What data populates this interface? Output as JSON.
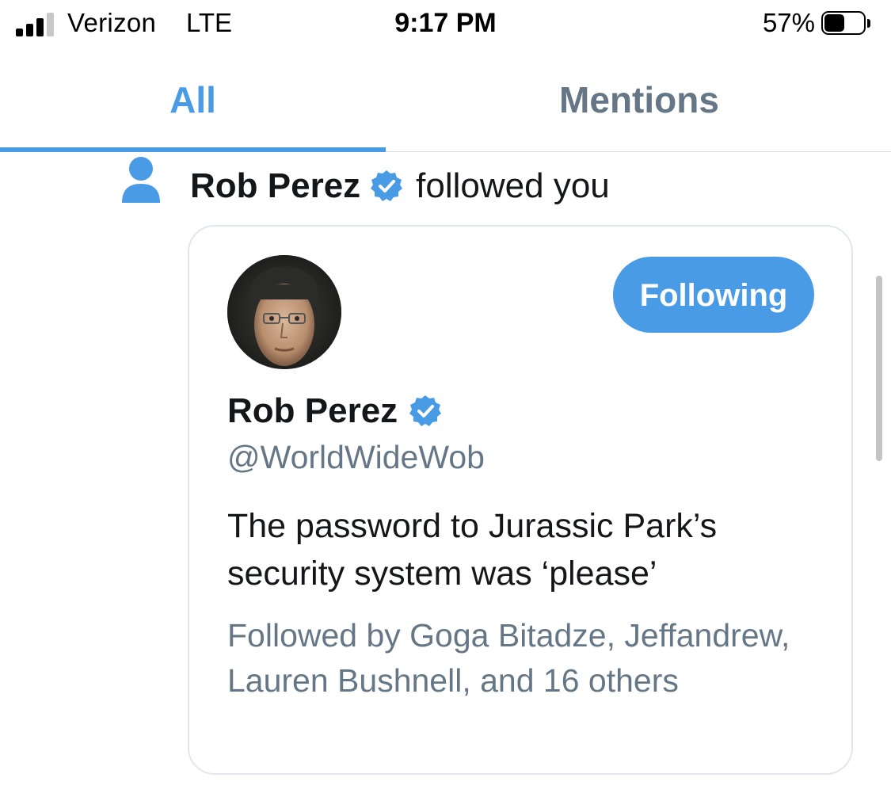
{
  "status_bar": {
    "carrier": "Verizon",
    "network": "LTE",
    "time": "9:17 PM",
    "battery_percent": "57%",
    "battery_level": 0.57,
    "signal_bars_filled": 3,
    "signal_bars_total": 4
  },
  "tabs": [
    {
      "label": "All",
      "selected": true
    },
    {
      "label": "Mentions",
      "selected": false
    }
  ],
  "notification": {
    "icon": "person-icon",
    "user_name": "Rob Perez",
    "verified": true,
    "action_text": "followed you"
  },
  "profile_card": {
    "avatar": "profile-photo",
    "name": "Rob Perez",
    "verified": true,
    "handle": "@WorldWideWob",
    "bio": "The password to Jurassic Park’s security system was ‘please’",
    "followed_by": "Followed by Goga Bitadze, Jeffandrew, Lauren Bushnell, and 16 others",
    "follow_button_label": "Following"
  },
  "colors": {
    "accent": "#4a9be6",
    "secondary_text": "#657786",
    "primary_text": "#14171a",
    "border": "#e1e8ed"
  }
}
